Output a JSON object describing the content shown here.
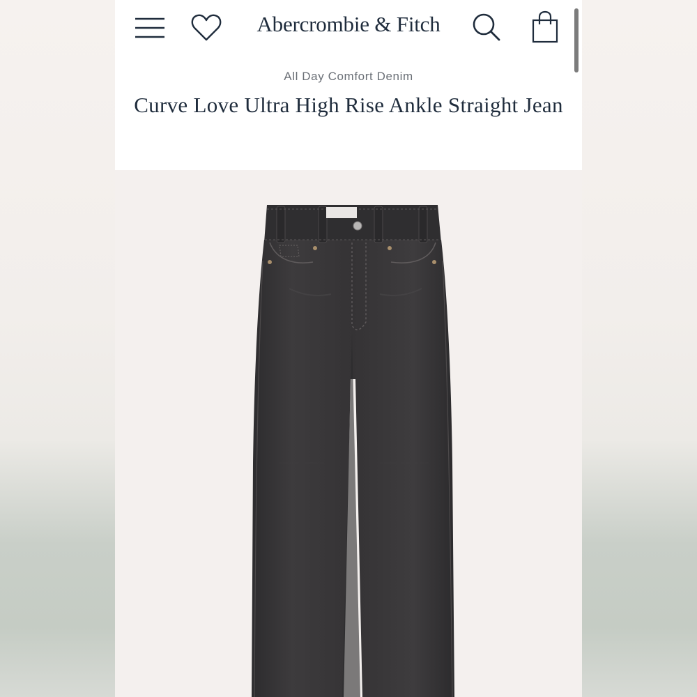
{
  "header": {
    "brand": "Abercrombie & Fitch",
    "icons": {
      "menu": "menu-icon",
      "wishlist": "heart-icon",
      "search": "search-icon",
      "bag": "shopping-bag-icon"
    }
  },
  "product": {
    "collection": "All Day Comfort Denim",
    "title": "Curve Love Ultra High Rise Ankle Straight Jean",
    "image": {
      "subject": "black washed high rise straight jeans"
    }
  },
  "colors": {
    "text_primary": "#1f2c3c",
    "text_secondary": "#6a6f76",
    "denim": "#3a3839",
    "image_background": "#f4f0ee"
  }
}
